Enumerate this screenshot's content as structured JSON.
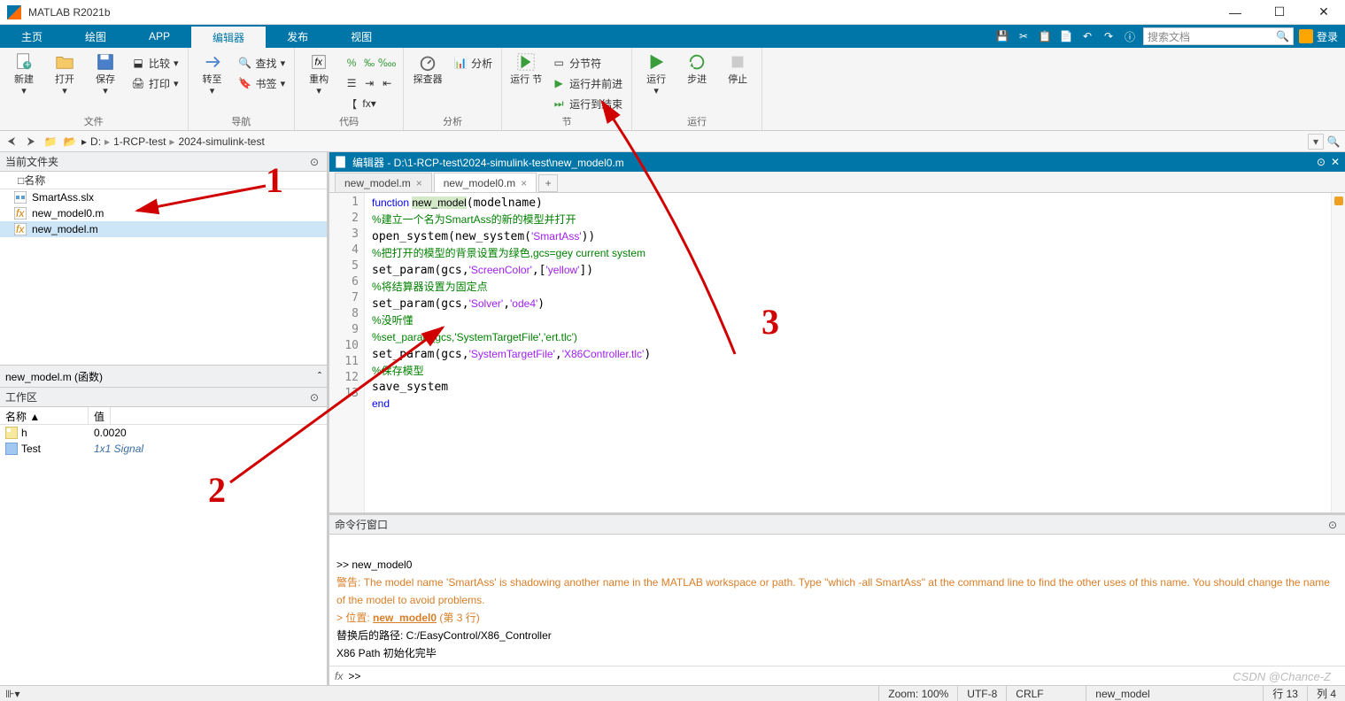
{
  "window": {
    "title": "MATLAB R2021b"
  },
  "ribbon": {
    "tabs": [
      "主页",
      "绘图",
      "APP",
      "编辑器",
      "发布",
      "视图"
    ],
    "active_tab": "编辑器",
    "search_placeholder": "搜索文档",
    "login": "登录"
  },
  "toolstrip": {
    "file": {
      "new": "新建",
      "open": "打开",
      "save": "保存",
      "compare": "比较",
      "print": "打印",
      "group": "文件"
    },
    "nav": {
      "goto": "转至",
      "find": "查找",
      "bookmark": "书签",
      "group": "导航"
    },
    "code": {
      "refactor": "重构",
      "analyze": "分析",
      "group": "代码"
    },
    "section": {
      "explorer": "探查器",
      "group": "分析"
    },
    "run": {
      "runsection": "运行\n节",
      "sectionbreak": "分节符",
      "runadvance": "运行并前进",
      "runtoend": "运行到结束",
      "group": "节"
    },
    "run2": {
      "run": "运行",
      "step": "步进",
      "stop": "停止",
      "group": "运行"
    }
  },
  "breadcrumb": {
    "drive": "D:",
    "parts": [
      "1-RCP-test",
      "2024-simulink-test"
    ]
  },
  "currentfolder": {
    "title": "当前文件夹",
    "namecol": "名称",
    "files": [
      {
        "name": "SmartAss.slx",
        "type": "slx"
      },
      {
        "name": "new_model0.m",
        "type": "m"
      },
      {
        "name": "new_model.m",
        "type": "m",
        "selected": true
      }
    ],
    "preview": "new_model.m (函数)"
  },
  "workspace": {
    "title": "工作区",
    "cols": [
      "名称 ▲",
      "值"
    ],
    "vars": [
      {
        "name": "h",
        "value": "0.0020",
        "icon": "num"
      },
      {
        "name": "Test",
        "value": "1x1 Signal",
        "icon": "obj",
        "italic": true
      }
    ]
  },
  "editor": {
    "title": "编辑器 - D:\\1-RCP-test\\2024-simulink-test\\new_model0.m",
    "tabs": [
      {
        "label": "new_model.m"
      },
      {
        "label": "new_model0.m",
        "active": true
      }
    ],
    "code_tokens": [
      [
        {
          "t": "function ",
          "c": "kw"
        },
        {
          "t": "new_model",
          "c": "hl"
        },
        {
          "t": "(modelname)"
        }
      ],
      [
        {
          "t": "%建立一个名为SmartAss的新的模型并打开",
          "c": "cm"
        }
      ],
      [
        {
          "t": "open_system(new_system("
        },
        {
          "t": "'SmartAss'",
          "c": "st"
        },
        {
          "t": "))"
        }
      ],
      [
        {
          "t": "%把打开的模型的背景设置为绿色,gcs=gey current system",
          "c": "cm"
        }
      ],
      [
        {
          "t": "set_param(gcs,"
        },
        {
          "t": "'ScreenColor'",
          "c": "st"
        },
        {
          "t": ",["
        },
        {
          "t": "'yellow'",
          "c": "st"
        },
        {
          "t": "])"
        }
      ],
      [
        {
          "t": "%将结算器设置为固定点",
          "c": "cm"
        }
      ],
      [
        {
          "t": "set_param(gcs,"
        },
        {
          "t": "'Solver'",
          "c": "st"
        },
        {
          "t": ","
        },
        {
          "t": "'ode4'",
          "c": "st"
        },
        {
          "t": ")"
        }
      ],
      [
        {
          "t": "%没听懂",
          "c": "cm"
        }
      ],
      [
        {
          "t": "%set_param(gcs,'SystemTargetFile','ert.tlc')",
          "c": "cm"
        }
      ],
      [
        {
          "t": "set_param(gcs,"
        },
        {
          "t": "'SystemTargetFile'",
          "c": "st"
        },
        {
          "t": ","
        },
        {
          "t": "'X86Controller.tlc'",
          "c": "st"
        },
        {
          "t": ")"
        }
      ],
      [
        {
          "t": "%保存模型",
          "c": "cm"
        }
      ],
      [
        {
          "t": "save_system"
        }
      ],
      [
        {
          "t": "end",
          "c": "kw"
        }
      ]
    ]
  },
  "command": {
    "title": "命令行窗口",
    "prompt_text": ">> new_model0",
    "warning_prefix": "警告:",
    "warning_body": " The model name 'SmartAss' is shadowing another name in the MATLAB workspace or path. Type \"which -all SmartAss\" at the command line to find the other uses of this name. You should change the name of the model to avoid problems.",
    "location_prefix": "> 位置: ",
    "location_link": "new_model0",
    "location_suffix": " (第 3 行)",
    "path_line": "替换后的路径: C:/EasyControl/X86_Controller",
    "init_line": "X86 Path 初始化完毕",
    "cursor": ">> "
  },
  "statusbar": {
    "zoom": "Zoom: 100%",
    "encoding": "UTF-8",
    "eol": "CRLF",
    "func": "new_model",
    "line": "行 13",
    "col": "列 4"
  },
  "watermark": "CSDN @Chance-Z",
  "annotations": {
    "n1": "1",
    "n2": "2",
    "n3": "3"
  }
}
